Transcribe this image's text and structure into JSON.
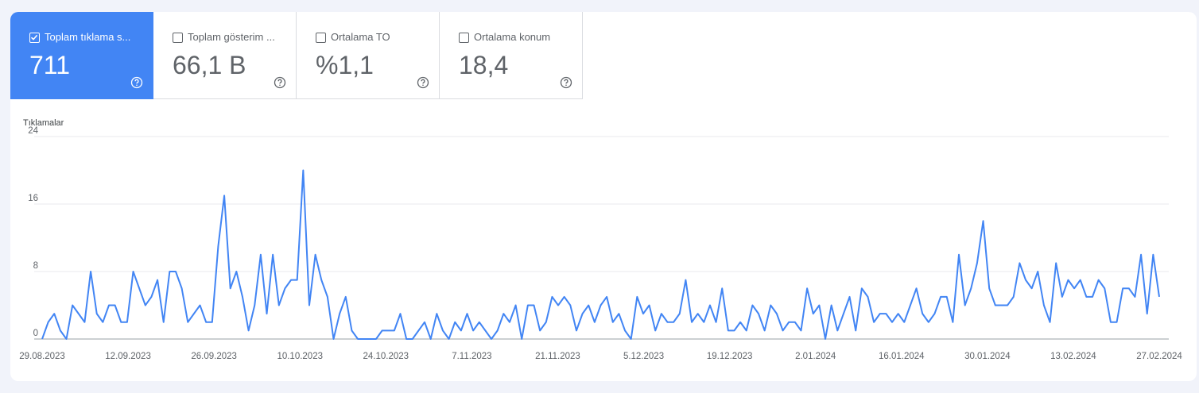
{
  "metrics": [
    {
      "label": "Toplam tıklama s...",
      "value": "711",
      "checked": true
    },
    {
      "label": "Toplam gösterim ...",
      "value": "66,1 B",
      "checked": false
    },
    {
      "label": "Ortalama TO",
      "value": "%1,1",
      "checked": false
    },
    {
      "label": "Ortalama konum",
      "value": "18,4",
      "checked": false
    }
  ],
  "colors": {
    "accent": "#4285f4",
    "line": "#4285f4",
    "grid": "#e8eaed"
  },
  "chart_data": {
    "type": "line",
    "title": "",
    "ylabel": "Tıklamalar",
    "xlabel": "",
    "ylim": [
      0,
      24
    ],
    "yticks": [
      "0",
      "8",
      "16",
      "24"
    ],
    "xtick_labels": [
      "29.08.2023",
      "12.09.2023",
      "26.09.2023",
      "10.10.2023",
      "24.10.2023",
      "7.11.2023",
      "21.11.2023",
      "5.12.2023",
      "19.12.2023",
      "2.01.2024",
      "16.01.2024",
      "30.01.2024",
      "13.02.2024",
      "27.02.2024"
    ],
    "grid": true,
    "legend": "none",
    "series": [
      {
        "values": [
          0,
          2,
          3,
          1,
          0,
          4,
          3,
          2,
          8,
          3,
          2,
          4,
          4,
          2,
          2,
          8,
          6,
          4,
          5,
          7,
          2,
          8,
          8,
          6,
          2,
          3,
          4,
          2,
          2,
          11,
          17,
          6,
          8,
          5,
          1,
          4,
          10,
          3,
          10,
          4,
          6,
          7,
          7,
          20,
          4,
          10,
          7,
          5,
          0,
          3,
          5,
          1,
          0,
          0,
          0,
          0,
          1,
          1,
          1,
          3,
          0,
          0,
          1,
          2,
          0,
          3,
          1,
          0,
          2,
          1,
          3,
          1,
          2,
          1,
          0,
          1,
          3,
          2,
          4,
          0,
          4,
          4,
          1,
          2,
          5,
          4,
          5,
          4,
          1,
          3,
          4,
          2,
          4,
          5,
          2,
          3,
          1,
          0,
          5,
          3,
          4,
          1,
          3,
          2,
          2,
          3,
          7,
          2,
          3,
          2,
          4,
          2,
          6,
          1,
          1,
          2,
          1,
          4,
          3,
          1,
          4,
          3,
          1,
          2,
          2,
          1,
          6,
          3,
          4,
          0,
          4,
          1,
          3,
          5,
          1,
          6,
          5,
          2,
          3,
          3,
          2,
          3,
          2,
          4,
          6,
          3,
          2,
          3,
          5,
          5,
          2,
          10,
          4,
          6,
          9,
          14,
          6,
          4,
          4,
          4,
          5,
          9,
          7,
          6,
          8,
          4,
          2,
          9,
          5,
          7,
          6,
          7,
          5,
          5,
          7,
          6,
          2,
          2,
          6,
          6,
          5,
          10,
          3,
          10,
          5
        ]
      }
    ]
  }
}
